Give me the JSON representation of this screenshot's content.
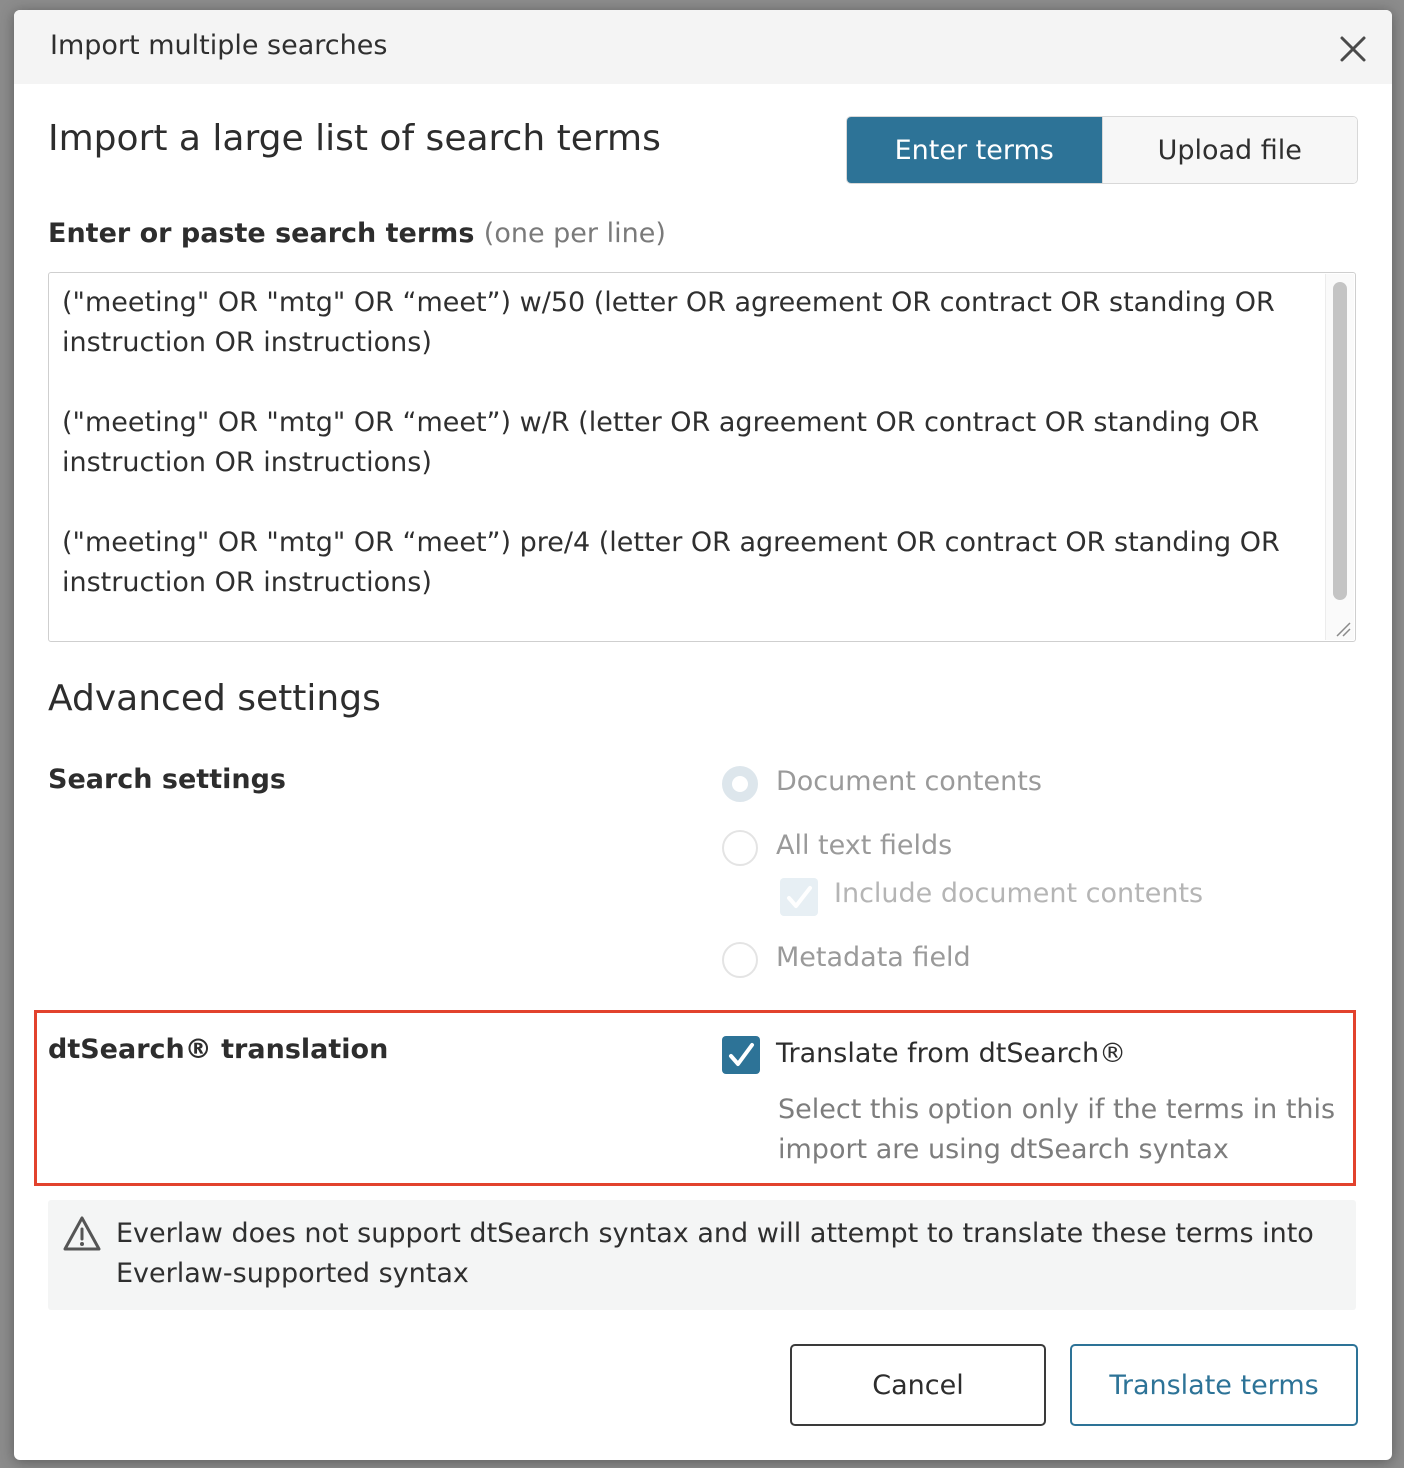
{
  "dialog": {
    "title": "Import multiple searches",
    "close_icon": "close-icon"
  },
  "import_section": {
    "title": "Import a large list of search terms",
    "tabs": [
      {
        "label": "Enter terms",
        "active": true
      },
      {
        "label": "Upload file",
        "active": false
      }
    ]
  },
  "terms_field": {
    "label": "Enter or paste search terms",
    "hint": "(one per line)",
    "value": "(\"meeting\" OR \"mtg\" OR “meet”) w/50 (letter OR agreement OR contract OR standing OR instruction OR instructions)\n\n(\"meeting\" OR \"mtg\" OR “meet”) w/R (letter OR agreement OR contract OR standing OR instruction OR instructions)\n\n(\"meeting\" OR \"mtg\" OR “meet”) pre/4 (letter OR agreement OR contract OR standing OR instruction OR instructions)"
  },
  "advanced": {
    "title": "Advanced settings",
    "search_settings": {
      "label": "Search settings",
      "options": [
        {
          "label": "Document contents",
          "selected": true
        },
        {
          "label": "All text fields",
          "selected": false
        },
        {
          "label": "Metadata field",
          "selected": false
        }
      ],
      "include_contents_label": "Include document contents"
    },
    "dtsearch": {
      "label": "dtSearch® translation",
      "checkbox_label": "Translate from dtSearch®",
      "checked": true,
      "description": "Select this option only if the terms in this import are using dtSearch syntax"
    }
  },
  "warning": {
    "icon": "warning-icon",
    "text": "Everlaw does not support dtSearch syntax and will attempt to translate these terms into Everlaw-supported syntax"
  },
  "footer": {
    "cancel_label": "Cancel",
    "submit_label": "Translate terms"
  },
  "colors": {
    "accent": "#2d7397",
    "highlight": "#e2422d"
  }
}
